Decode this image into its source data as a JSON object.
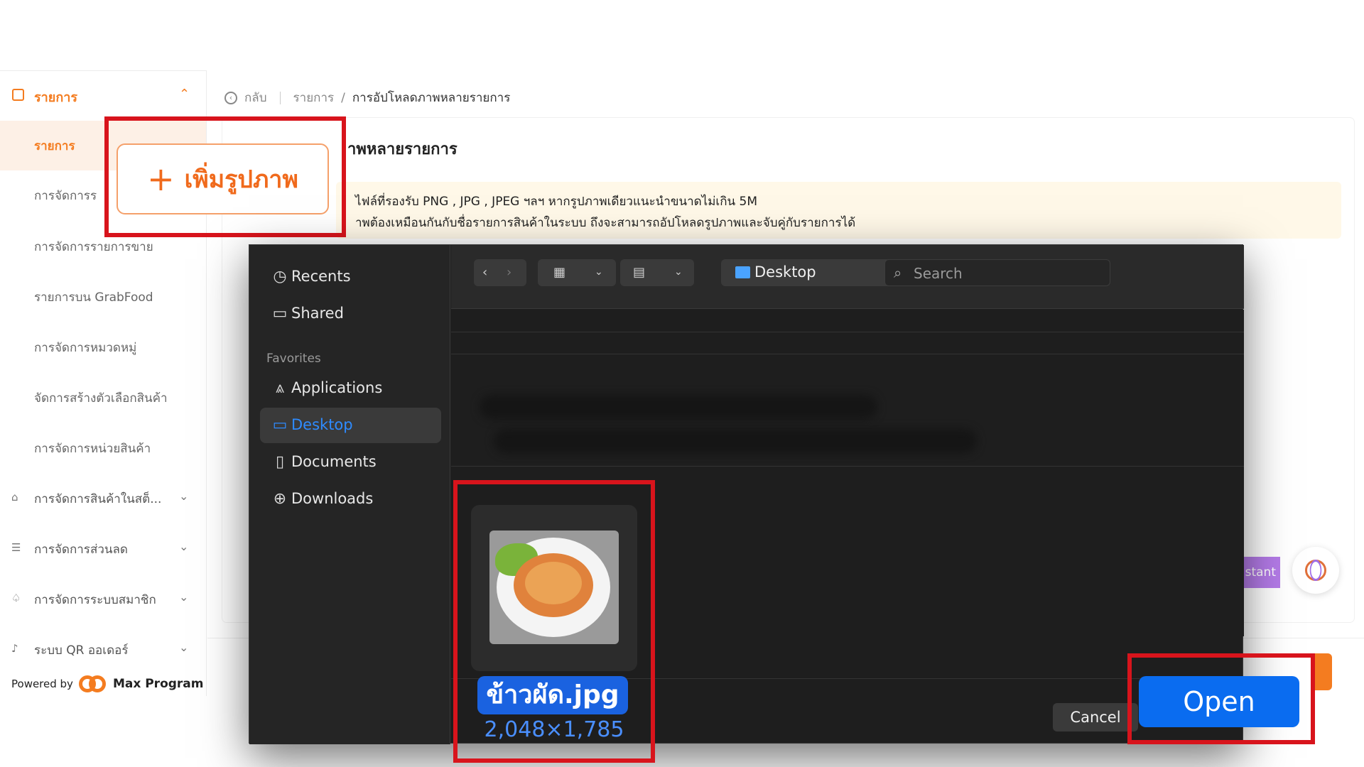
{
  "sidebar": {
    "section_label": "รายการ",
    "sub_items": [
      {
        "label": "รายการ",
        "active": true
      },
      {
        "label": "การจัดการร"
      },
      {
        "label": "การจัดการรายการขาย"
      },
      {
        "label": "รายการบน GrabFood"
      },
      {
        "label": "การจัดการหมวดหมู่"
      },
      {
        "label": "จัดการสร้างตัวเลือกสินค้า"
      },
      {
        "label": "การจัดการหน่วยสินค้า"
      }
    ],
    "groups": [
      {
        "label": "การจัดการสินค้าในสต็...",
        "icon": "warehouse-icon"
      },
      {
        "label": "การจัดการส่วนลด",
        "icon": "discount-icon"
      },
      {
        "label": "การจัดการระบบสมาชิก",
        "icon": "member-icon"
      },
      {
        "label": "ระบบ QR ออเดอร์",
        "icon": "bell-icon"
      }
    ],
    "powered_by": "Powered by",
    "brand": "Max Program"
  },
  "breadcrumb": {
    "back": "กลับ",
    "parent": "รายการ",
    "separator": "/",
    "current": "การอัปโหลดภาพหลายรายการ"
  },
  "card": {
    "title": "าพหลายรายการ",
    "notice_line1": "ไฟล์ที่รองรับ PNG , JPG , JPEG ฯลฯ หากรูปภาพเดียวแนะนำขนาดไม่เกิน 5M",
    "notice_line2": "าพต้องเหมือนกันกับชื่อรายการสินค้าในระบบ ถึงจะสามารถอัปโหลดรูปภาพและจับคู่กับรายการได้"
  },
  "add_image_button": "เพิ่มรูปภาพ",
  "assistant_label": "stant",
  "dialog": {
    "sidebar": {
      "recents": "Recents",
      "shared": "Shared",
      "favorites_heading": "Favorites",
      "applications": "Applications",
      "desktop": "Desktop",
      "documents": "Documents",
      "downloads": "Downloads"
    },
    "location": "Desktop",
    "search_placeholder": "Search",
    "file": {
      "name": "ข้าวผัด.jpg",
      "dimensions": "2,048×1,785"
    },
    "cancel": "Cancel",
    "open": "Open"
  },
  "colors": {
    "accent_orange": "#f47c20",
    "highlight_red": "#d8141c",
    "mac_blue": "#0a6cf0"
  }
}
